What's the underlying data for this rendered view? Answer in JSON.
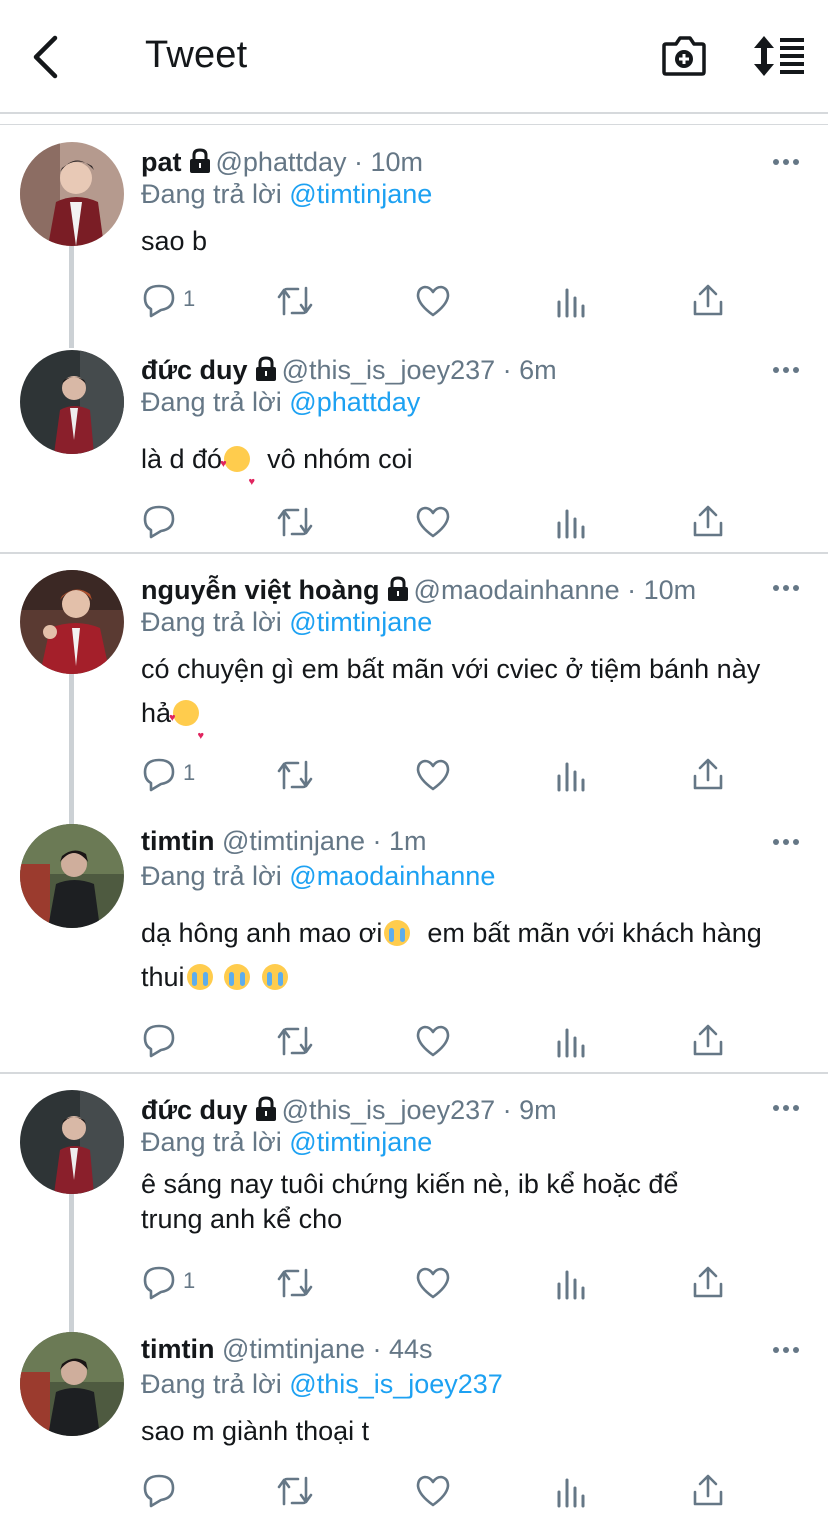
{
  "header": {
    "title": "Tweet"
  },
  "reply_prefix": "Đang trả lời",
  "tweets": [
    {
      "name": "pat",
      "locked": true,
      "handle": "@phattday",
      "time": "10m",
      "reply_to": "@timtinjane",
      "text": "sao b",
      "reply_count": "1"
    },
    {
      "name": "đức duy",
      "locked": true,
      "handle": "@this_is_joey237",
      "time": "6m",
      "reply_to": "@phattday",
      "text": "là d đó",
      "text_after": "  vô nhóm coi",
      "reply_count": ""
    },
    {
      "name": "nguyễn việt hoàng",
      "locked": true,
      "handle": "@maodainhanne",
      "time": "10m",
      "reply_to": "@timtinjane",
      "text": "có chuyện gì em bất mãn với cviec ở tiệm bánh này hả",
      "reply_count": "1"
    },
    {
      "name": "timtin",
      "locked": false,
      "handle": "@timtinjane",
      "time": "1m",
      "reply_to": "@maodainhanne",
      "text": "dạ hông anh mao ơi",
      "text_after": "  em bất mãn với khách hàng thui",
      "reply_count": ""
    },
    {
      "name": "đức duy",
      "locked": true,
      "handle": "@this_is_joey237",
      "time": "9m",
      "reply_to": "@timtinjane",
      "text": "ê sáng nay tuôi chứng kiến nè, ib kể hoặc để trung anh kể cho",
      "reply_count": "1"
    },
    {
      "name": "timtin",
      "locked": false,
      "handle": "@timtinjane",
      "time": "44s",
      "reply_to": "@this_is_joey237",
      "text": "sao m giành thoại t",
      "reply_count": ""
    }
  ],
  "colors": {
    "accent": "#1da1f2",
    "muted": "#657786",
    "text": "#14171a",
    "divider": "#d6d9dc"
  },
  "icons": [
    "back-arrow-icon",
    "camera-plus-icon",
    "sort-icon",
    "lock-icon",
    "more-icon",
    "reply-icon",
    "retweet-icon",
    "like-icon",
    "analytics-icon",
    "share-icon"
  ]
}
